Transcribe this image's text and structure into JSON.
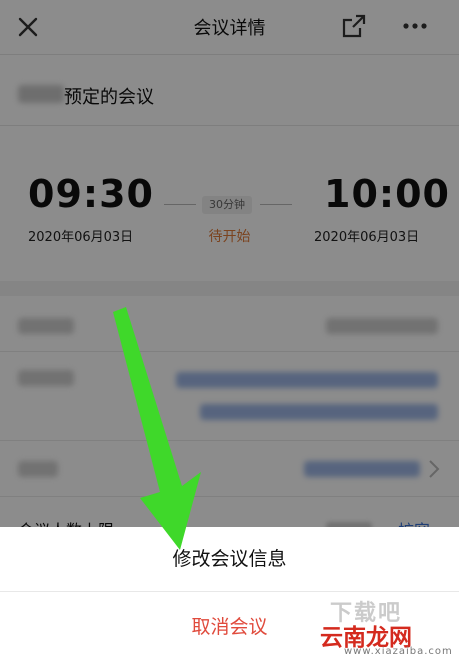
{
  "header": {
    "title": "会议详情",
    "close_icon": "close-icon",
    "share_icon": "share-icon",
    "more_icon": "more-icon"
  },
  "meeting": {
    "name_visible": "预定的会议"
  },
  "schedule": {
    "start_time": "09:30",
    "start_date": "2020年06月03日",
    "duration": "30分钟",
    "status": "待开始",
    "end_time": "10:00",
    "end_date": "2020年06月03日"
  },
  "info": {
    "participant_limit_label": "会议人数上限",
    "expand_label": "扩容"
  },
  "action_sheet": {
    "edit_label": "修改会议信息",
    "cancel_label": "取消会议"
  },
  "watermark": {
    "top": "下载吧",
    "main": "云南龙网",
    "site": "www.xiazaiba.com"
  },
  "colors": {
    "status_orange": "#e07b39",
    "link_blue": "#3a72d6",
    "cancel_red": "#e04a3c",
    "arrow_green": "#3fd82a"
  }
}
